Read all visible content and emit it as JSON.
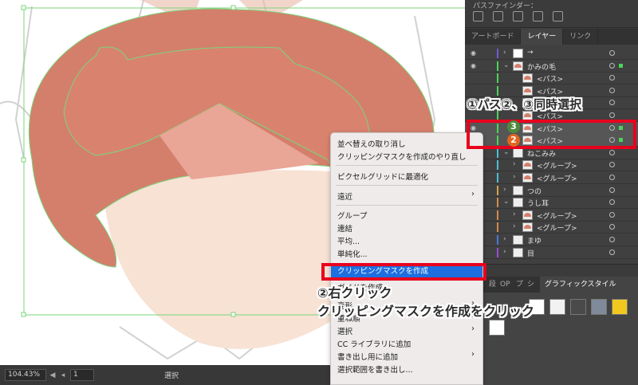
{
  "panels": {
    "pathfinder_title": "パスファインダー：",
    "tabs": [
      "アートボード",
      "レイヤー",
      "リンク"
    ],
    "graphic_style_tabs": [
      "段",
      "OP",
      "プ",
      "シ"
    ],
    "graphic_style_active": "グラフィックスタイル"
  },
  "layers": [
    {
      "label": "→"
    },
    {
      "label": "かみの毛"
    },
    {
      "label": "<パス>"
    },
    {
      "label": "<パス>"
    },
    {
      "label": "<パス>"
    },
    {
      "label": "<パス>"
    },
    {
      "label": "<パス>"
    },
    {
      "label": "<パス>"
    },
    {
      "label": "ねこみみ"
    },
    {
      "label": "<グループ>"
    },
    {
      "label": "<グループ>"
    },
    {
      "label": "つの"
    },
    {
      "label": "うし耳"
    },
    {
      "label": "<グループ>"
    },
    {
      "label": "<グループ>"
    },
    {
      "label": "まゆ"
    },
    {
      "label": "目"
    }
  ],
  "context_menu": {
    "items": [
      "並べ替えの取り消し",
      "クリッピングマスクを作成のやり直し",
      "ピクセルグリッドに最適化",
      "遠近",
      "グループ",
      "連結",
      "平均...",
      "単純化...",
      "クリッピングマスクを作成",
      "ガイドを作成",
      "変形",
      "重ね順",
      "選択",
      "CC ライブラリに追加",
      "書き出し用に追加",
      "選択範囲を書き出し..."
    ]
  },
  "status": {
    "zoom": "104.43%",
    "page": "1",
    "tool": "選択"
  },
  "annotations": {
    "select": "①パス②、③同時選択",
    "badge_3": "3",
    "badge_2": "2",
    "right_click": "②右クリック",
    "instruction": "クリッピングマスクを作成をクリック"
  },
  "colors": {
    "hair": "#d47f6c",
    "face": "#f7e2d4",
    "selection": "#7ad67a",
    "annotation_red": "#e8001d",
    "menu_highlight": "#1d6fe0"
  }
}
